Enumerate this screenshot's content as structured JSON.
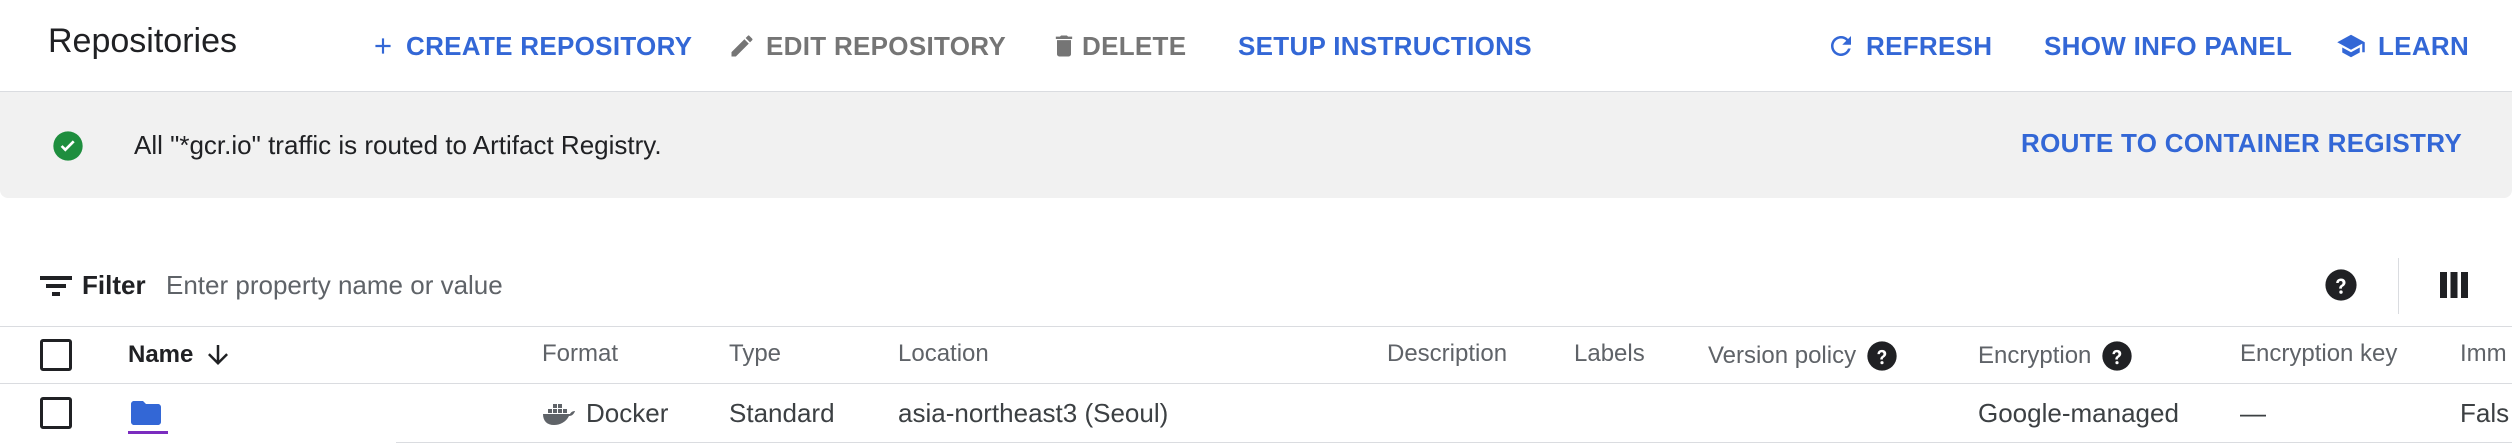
{
  "header": {
    "title": "Repositories",
    "actions": {
      "create": "CREATE REPOSITORY",
      "edit": "EDIT REPOSITORY",
      "delete": "DELETE",
      "setup": "SETUP INSTRUCTIONS",
      "refresh": "REFRESH",
      "info_panel": "SHOW INFO PANEL",
      "learn": "LEARN"
    }
  },
  "banner": {
    "message": "All \"*gcr.io\" traffic is routed to Artifact Registry.",
    "action": "ROUTE TO CONTAINER REGISTRY",
    "status_color": "#1e8e3e"
  },
  "filter": {
    "label": "Filter",
    "placeholder": "Enter property name or value"
  },
  "table": {
    "columns": {
      "name": "Name",
      "format": "Format",
      "type": "Type",
      "location": "Location",
      "description": "Description",
      "labels": "Labels",
      "version_policy": "Version policy",
      "encryption": "Encryption",
      "encryption_key": "Encryption key",
      "immutable": "Imm"
    },
    "rows": [
      {
        "format": "Docker",
        "type": "Standard",
        "location": "asia-northeast3 (Seoul)",
        "encryption": "Google-managed",
        "encryption_key": "—",
        "immutable": "Fals"
      }
    ]
  },
  "colors": {
    "accent": "#3367d6",
    "disabled": "#757575",
    "banner_bg": "#f1f1f1"
  }
}
